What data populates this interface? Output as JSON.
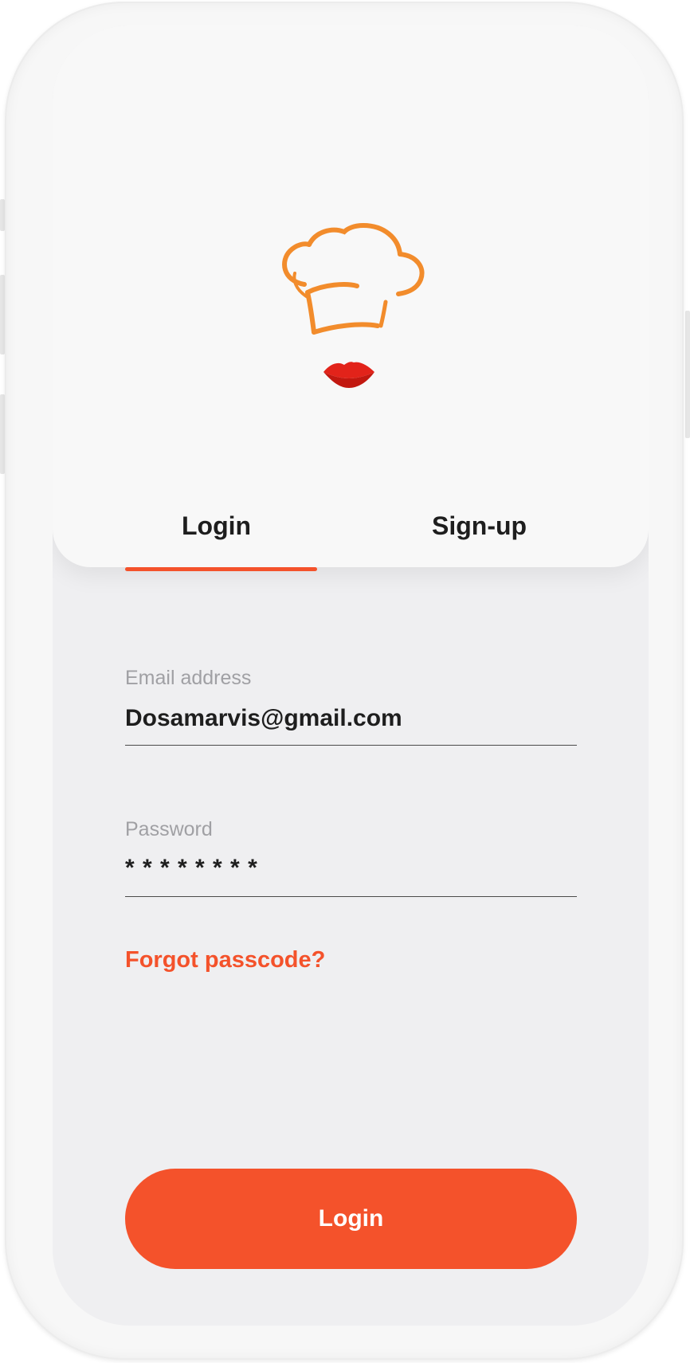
{
  "brand": {
    "logo_icon": "chef-hat-with-lips-icon",
    "hat_color": "#f28c2c",
    "lips_color": "#e2231a",
    "accent": "#f4522b"
  },
  "tabs": {
    "login_label": "Login",
    "signup_label": "Sign-up",
    "active": "Login"
  },
  "form": {
    "email": {
      "label": "Email address",
      "value": "Dosamarvis@gmail.com"
    },
    "password": {
      "label": "Password",
      "value": "* * * * * * * *"
    },
    "forgot_label": "Forgot passcode?",
    "submit_label": "Login"
  }
}
